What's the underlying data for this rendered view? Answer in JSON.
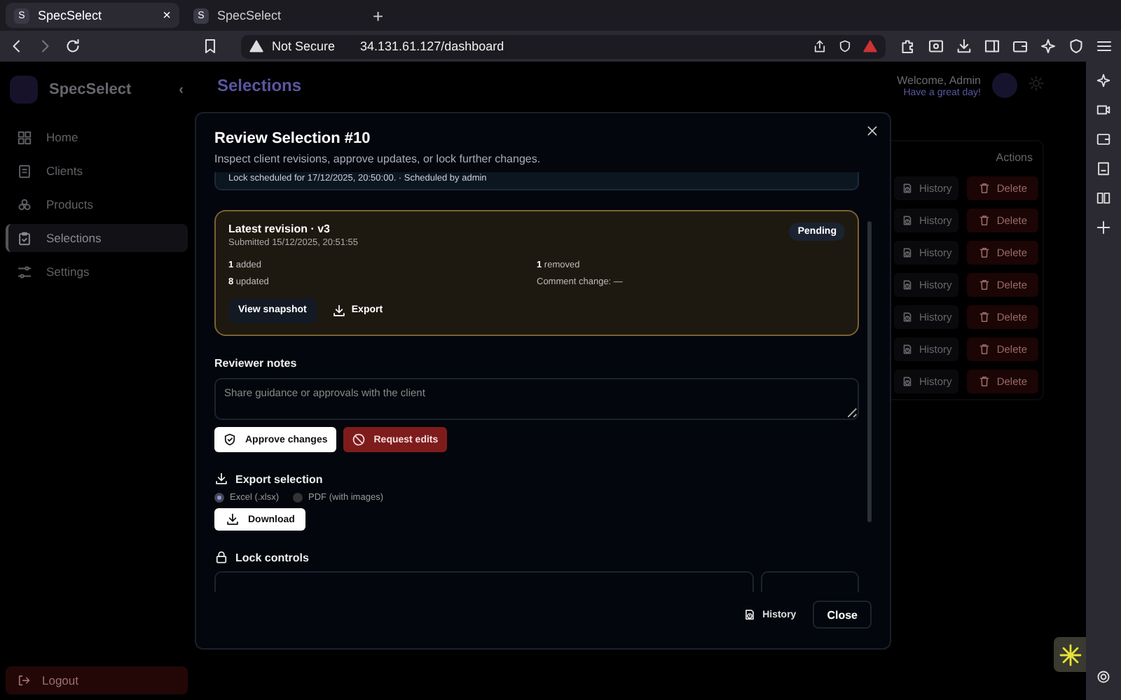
{
  "browser": {
    "tabs": [
      {
        "favicon": "S",
        "title": "SpecSelect",
        "selected": true,
        "close": "×"
      },
      {
        "favicon": "S",
        "title": "SpecSelect",
        "selected": false
      }
    ],
    "new_tab": "+",
    "security": "Not Secure",
    "url": "34.131.61.127/dashboard"
  },
  "sidebar": {
    "brand": "SpecSelect",
    "collapse": "‹",
    "items": [
      {
        "label": "Home",
        "selected": false
      },
      {
        "label": "Clients",
        "selected": false
      },
      {
        "label": "Products",
        "selected": false
      },
      {
        "label": "Selections",
        "selected": true
      },
      {
        "label": "Settings",
        "selected": false
      }
    ],
    "logout": "Logout"
  },
  "header": {
    "title": "Selections",
    "welcome": "Welcome, Admin",
    "greeting": "Have a great day!"
  },
  "table": {
    "columns": [
      "Actions"
    ],
    "rows": [
      {
        "history": "History",
        "delete": "Delete"
      },
      {
        "history": "History",
        "delete": "Delete"
      },
      {
        "history": "History",
        "delete": "Delete"
      },
      {
        "history": "History",
        "delete": "Delete"
      },
      {
        "history": "History",
        "delete": "Delete"
      },
      {
        "history": "History",
        "delete": "Delete"
      },
      {
        "history": "History",
        "delete": "Delete"
      }
    ]
  },
  "modal": {
    "title": "Review Selection #10",
    "subtitle": "Inspect client revisions, approve updates, or lock further changes.",
    "lock_note": "Lock scheduled for 17/12/2025, 20:50:00. · Scheduled by admin",
    "revision": {
      "title": "Latest revision · v3",
      "submitted": "Submitted 15/12/2025, 20:51:55",
      "status": "Pending",
      "stats": [
        "**1** added",
        "**1** removed",
        "**8** updated",
        "Comment change: —"
      ],
      "actions": [
        {
          "label": "View snapshot",
          "kind": "filled"
        },
        {
          "label": "Export",
          "kind": "export"
        }
      ]
    },
    "notes": {
      "label": "Reviewer notes",
      "placeholder": "Share guidance or approvals with the client"
    },
    "decisions": [
      {
        "label": "Approve changes",
        "kind": "approve"
      },
      {
        "label": "Request edits",
        "kind": "reject"
      }
    ],
    "export": {
      "title": "Export selection",
      "formats": [
        {
          "label": "Excel (.xlsx)",
          "selected": true
        },
        {
          "label": "PDF (with images)",
          "selected": false
        }
      ],
      "button": "Download"
    },
    "lock": {
      "title": "Lock controls"
    },
    "footer": {
      "history": "History",
      "close": "Close"
    }
  }
}
